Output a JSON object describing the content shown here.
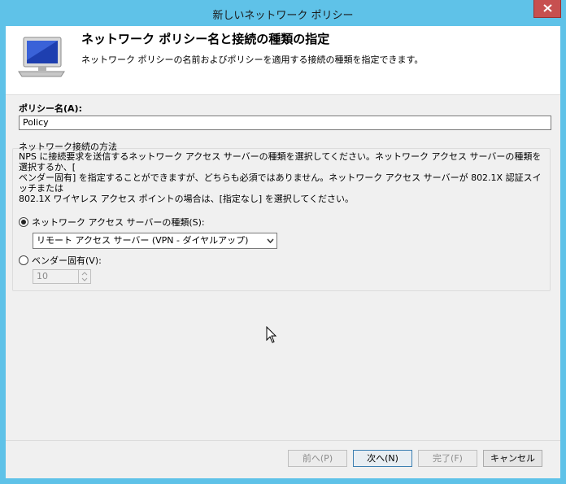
{
  "window": {
    "title": "新しいネットワーク ポリシー"
  },
  "header": {
    "title": "ネットワーク ポリシー名と接続の種類の指定",
    "subtitle": "ネットワーク ポリシーの名前およびポリシーを適用する接続の種類を指定できます。"
  },
  "policy_name": {
    "label": "ポリシー名(A):",
    "value": "Policy"
  },
  "connection_method": {
    "legend": "ネットワーク接続の方法",
    "description_lines": [
      "NPS に接続要求を送信するネットワーク アクセス サーバーの種類を選択してください。ネットワーク アクセス サーバーの種類を選択するか、[",
      "ベンダー固有] を指定することができますが、どちらも必須ではありません。ネットワーク アクセス サーバーが 802.1X 認証スイッチまたは",
      "802.1X ワイヤレス アクセス ポイントの場合は、[指定なし] を選択してください。"
    ],
    "option_type": {
      "label": "ネットワーク アクセス サーバーの種類(S):",
      "checked": true
    },
    "type_select": {
      "value": "リモート アクセス サーバー (VPN - ダイヤルアップ)"
    },
    "option_vendor": {
      "label": "ベンダー固有(V):",
      "checked": false
    },
    "vendor_spinner": {
      "value": "10"
    }
  },
  "buttons": {
    "back": "前へ(P)",
    "next": "次へ(N)",
    "finish": "完了(F)",
    "cancel": "キャンセル"
  }
}
